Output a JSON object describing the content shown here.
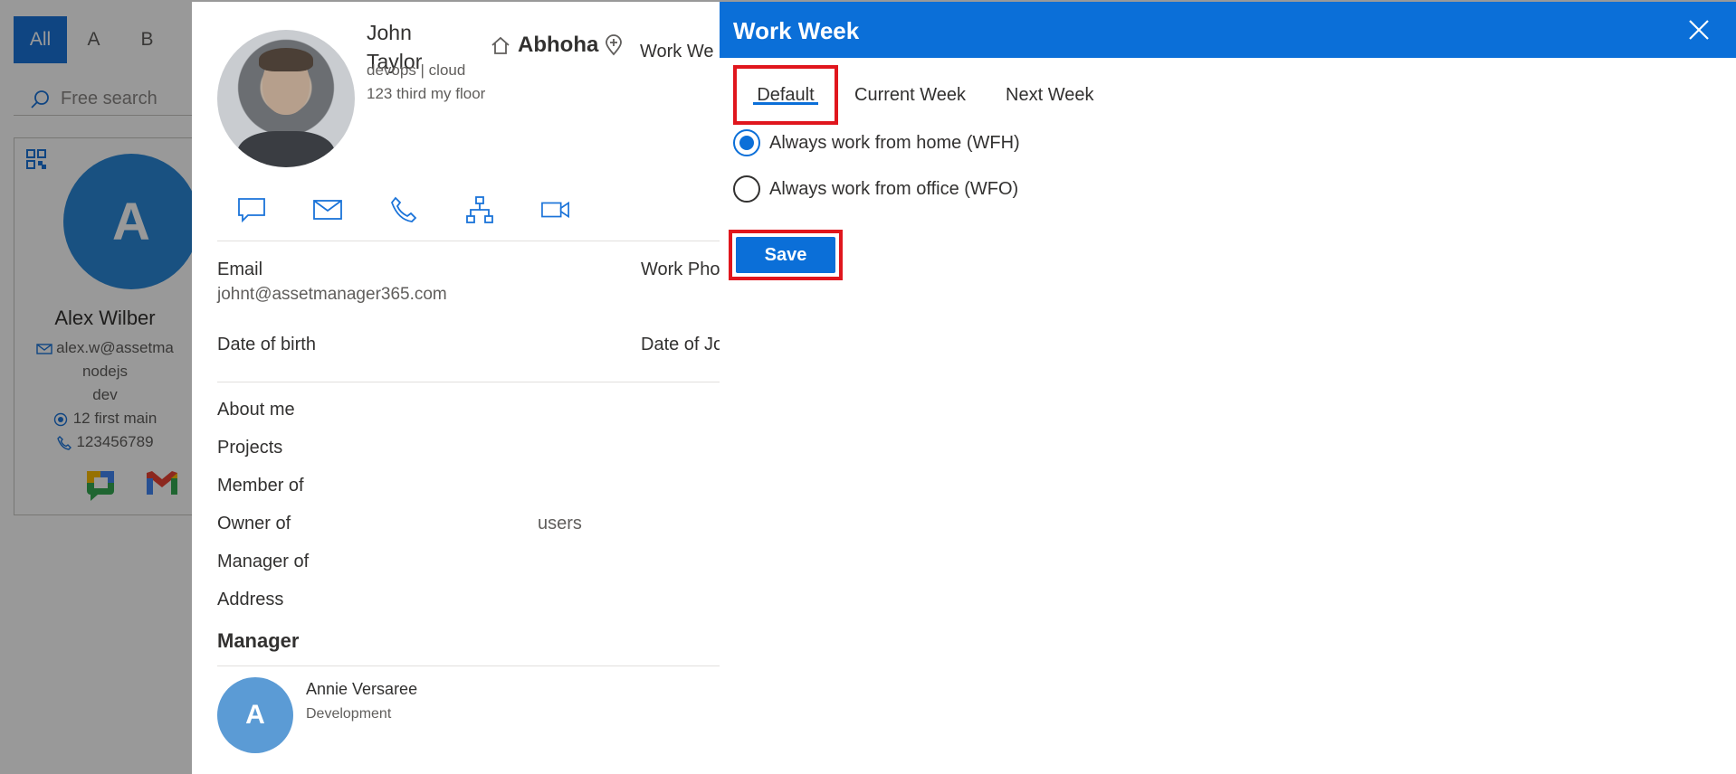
{
  "directory": {
    "alpha_tabs": [
      "All",
      "A",
      "B"
    ],
    "search_placeholder": "Free search",
    "card": {
      "initial": "A",
      "name": "Alex Wilber",
      "email": "alex.w@assetma",
      "skill": "nodejs",
      "role": "dev",
      "address": "12 first main",
      "phone": "123456789"
    }
  },
  "profile": {
    "name": "John Taylor",
    "subtitle": "devops | cloud",
    "address_line": "123 third my floor",
    "home_label": "Abhoha",
    "workweek_label": "Work We",
    "fields": {
      "email_label": "Email",
      "email_value": "johnt@assetmanager365.com",
      "work_phone_label": "Work Pho",
      "dob_label": "Date of birth",
      "doj_label": "Date of Jo",
      "about_label": "About me",
      "projects_label": "Projects",
      "member_label": "Member of",
      "owner_label": "Owner of",
      "owner_value": "users",
      "manager_of_label": "Manager of",
      "address_label": "Address"
    },
    "manager": {
      "heading": "Manager",
      "initial": "A",
      "name": "Annie Versaree",
      "department": "Development"
    }
  },
  "work_week": {
    "title": "Work Week",
    "tabs": [
      "Default",
      "Current Week",
      "Next Week"
    ],
    "options": [
      {
        "label": "Always work from home (WFH)",
        "checked": true
      },
      {
        "label": "Always work from office (WFO)",
        "checked": false
      }
    ],
    "save_label": "Save",
    "accent": "#0b6fd8",
    "highlight": "#e0161d"
  }
}
